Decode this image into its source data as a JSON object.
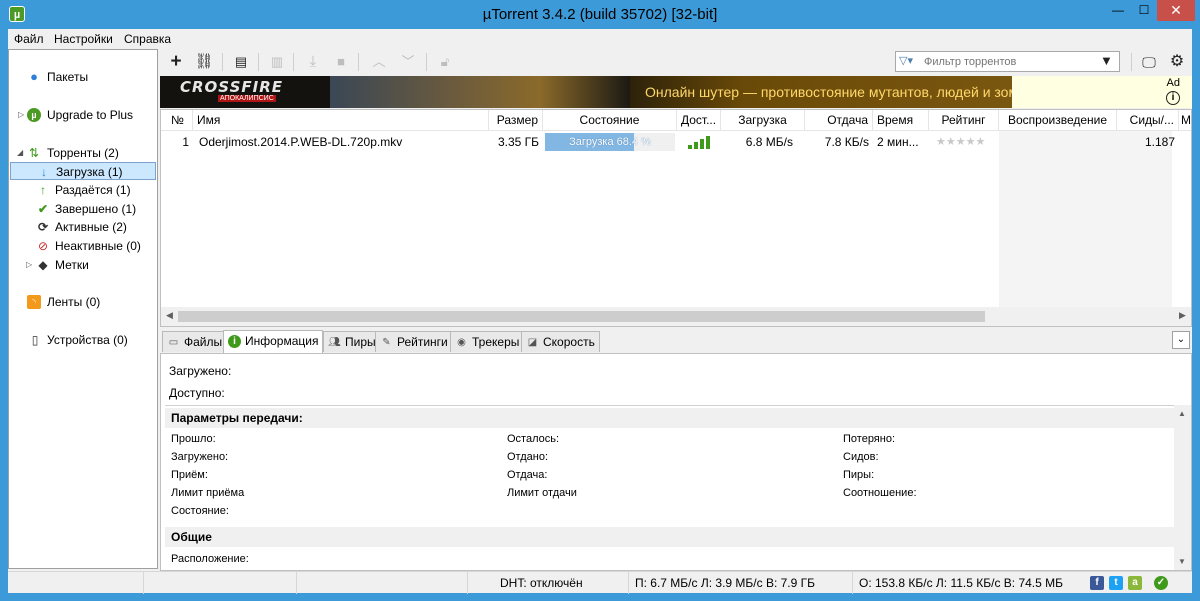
{
  "window": {
    "title": "µTorrent 3.4.2  (build 35702) [32-bit]",
    "minimize_glyph": "—",
    "maximize_glyph": "☐",
    "close_glyph": "✕"
  },
  "menu": [
    "Файл",
    "Настройки",
    "Справка"
  ],
  "sidebar": {
    "items": [
      {
        "label": "Пакеты",
        "icon": "bundles-icon"
      },
      {
        "label": "Upgrade to Plus",
        "icon": "utorrent-plus-icon"
      },
      {
        "label": "Торренты (2)",
        "icon": "torrents-icon"
      },
      {
        "label": "Загрузка (1)",
        "icon": "download-arrow-icon",
        "selected": true
      },
      {
        "label": "Раздаётся (1)",
        "icon": "seeding-arrow-icon"
      },
      {
        "label": "Завершено (1)",
        "icon": "completed-check-icon"
      },
      {
        "label": "Активные (2)",
        "icon": "active-refresh-icon"
      },
      {
        "label": "Неактивные (0)",
        "icon": "inactive-icon"
      },
      {
        "label": "Метки",
        "icon": "labels-tag-icon"
      },
      {
        "label": "Ленты (0)",
        "icon": "rss-feeds-icon"
      },
      {
        "label": "Устройства (0)",
        "icon": "devices-phone-icon"
      }
    ]
  },
  "toolbar": {
    "filter_placeholder": "Фильтр торрентов"
  },
  "ad": {
    "logo": "CROSSFIRE",
    "logo_sub": "АПОКАЛИПСИС",
    "headline": "Онлайн шутер — противостояние мутантов, людей и зомби",
    "ad_label": "Ad",
    "info_glyph": "i"
  },
  "torrent_list": {
    "columns": [
      "№",
      "Имя",
      "Размер",
      "Состояние",
      "Дост...",
      "Загрузка",
      "Отдача",
      "Время",
      "Рейтинг",
      "Воспроизведение",
      "Сиды/...",
      "M"
    ],
    "rows": [
      {
        "num": "1",
        "name": "Oderjimost.2014.P.WEB-DL.720p.mkv",
        "size": "3.35 ГБ",
        "status": "Загрузка 68.4 %",
        "progress": 0.684,
        "availability_bars": 4,
        "down_speed": "6.8 МБ/s",
        "up_speed": "7.8 КБ/s",
        "eta": "2 мин...",
        "rating": "★★★★★",
        "seeds": "1.187"
      }
    ]
  },
  "tabs": [
    {
      "label": "Файлы",
      "icon": "files-icon"
    },
    {
      "label": "Информация",
      "icon": "info-icon",
      "active": true
    },
    {
      "label": "Пиры",
      "icon": "peers-icon"
    },
    {
      "label": "Рейтинги",
      "icon": "ratings-icon"
    },
    {
      "label": "Трекеры",
      "icon": "trackers-icon"
    },
    {
      "label": "Скорость",
      "icon": "speed-graph-icon"
    }
  ],
  "info": {
    "downloaded": "Загружено:",
    "available": "Доступно:",
    "transfer_header": "Параметры передачи:",
    "transfer": [
      [
        "Прошло:",
        "Осталось:",
        "Потеряно:"
      ],
      [
        "Загружено:",
        "Отдано:",
        "Сидов:"
      ],
      [
        "Приём:",
        "Отдача:",
        "Пиры:"
      ],
      [
        "Лимит приёма",
        "Лимит отдачи",
        "Соотношение:"
      ],
      [
        "Состояние:",
        "",
        ""
      ]
    ],
    "general_header": "Общие",
    "location": "Расположение:"
  },
  "statusbar": {
    "dht": "DHT: отключён",
    "download": "П: 6.7 МБ/с Л: 3.9 МБ/с В: 7.9 ГБ",
    "upload": "О: 153.8 КБ/с Л: 11.5 КБ/с В: 74.5 МБ"
  },
  "colors": {
    "titlebar": "#3c9ad8",
    "progress_fill": "#83b7e3",
    "signal": "#3f9a1c",
    "close_button": "#c7504b"
  }
}
